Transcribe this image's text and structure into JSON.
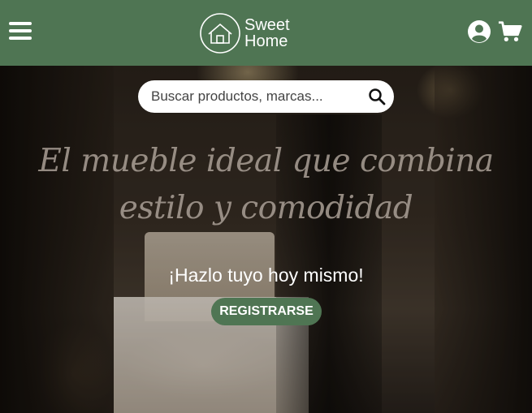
{
  "navbar": {
    "brand_line1": "Sweet",
    "brand_line2": "Home",
    "bg_color": "#4f7553"
  },
  "search": {
    "placeholder": "Buscar productos, marcas..."
  },
  "hero": {
    "headline_line1": "El mueble ideal que combina",
    "headline_line2": "estilo y comodidad",
    "cta_text": "¡Hazlo tuyo hoy mismo!",
    "cta_button": "REGISTRARSE"
  },
  "icons": [
    "menu-icon",
    "house-logo-icon",
    "user-account-icon",
    "shopping-cart-icon",
    "search-icon"
  ]
}
